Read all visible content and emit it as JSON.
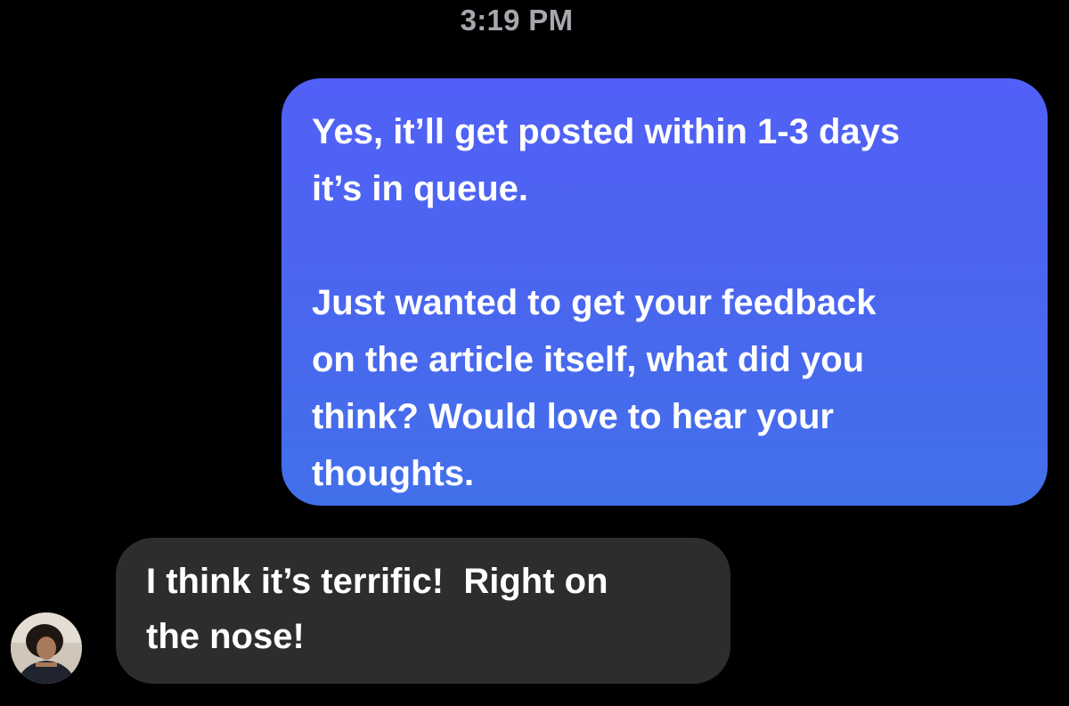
{
  "conversation": {
    "timestamp": "3:19 PM",
    "sent_message": {
      "paragraph_1": "Yes, it’ll get posted within 1-3 days\nit’s in queue.",
      "paragraph_2": "Just wanted to get your feedback\non the article itself, what did you\nthink? Would love to hear your\nthoughts."
    },
    "received_message": {
      "text": "I think it’s terrific!  Right on\nthe nose!"
    }
  },
  "colors": {
    "background": "#000000",
    "sent_bubble": "#4a66ef",
    "received_bubble": "#2d2d2f",
    "timestamp_text": "#a7a7ad",
    "message_text": "#ffffff"
  },
  "icons": {
    "avatar": "contact-avatar-photo"
  }
}
